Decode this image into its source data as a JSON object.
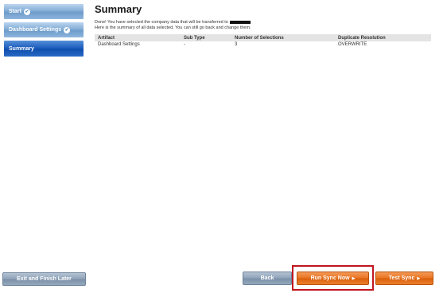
{
  "sidebar": {
    "steps": [
      {
        "label": "Start",
        "check": "✔"
      },
      {
        "label": "Dashboard Settings",
        "check": "✔"
      },
      {
        "label": "Summary"
      }
    ]
  },
  "main": {
    "title": "Summary",
    "intro_line1": "Done! You have selected the company data that will be transferred to",
    "intro_line2": "Here is the summary of all data selected. You can still go back and change them.",
    "table": {
      "headers": [
        "Artifact",
        "Sub Type",
        "Number of Selections",
        "Duplicate Resolution"
      ],
      "rows": [
        [
          "Dashboard Settings",
          "-",
          "3",
          "OVERWRITE"
        ]
      ]
    }
  },
  "footer": {
    "exit_label": "Exit and Finish Later",
    "back_label": "Back",
    "run_label": "Run Sync Now",
    "test_label": "Test Sync",
    "arrow": "▶"
  },
  "colors": {
    "accent_blue": "#1f5fbf",
    "orange": "#e8731f",
    "highlight_red": "#c0161f"
  }
}
